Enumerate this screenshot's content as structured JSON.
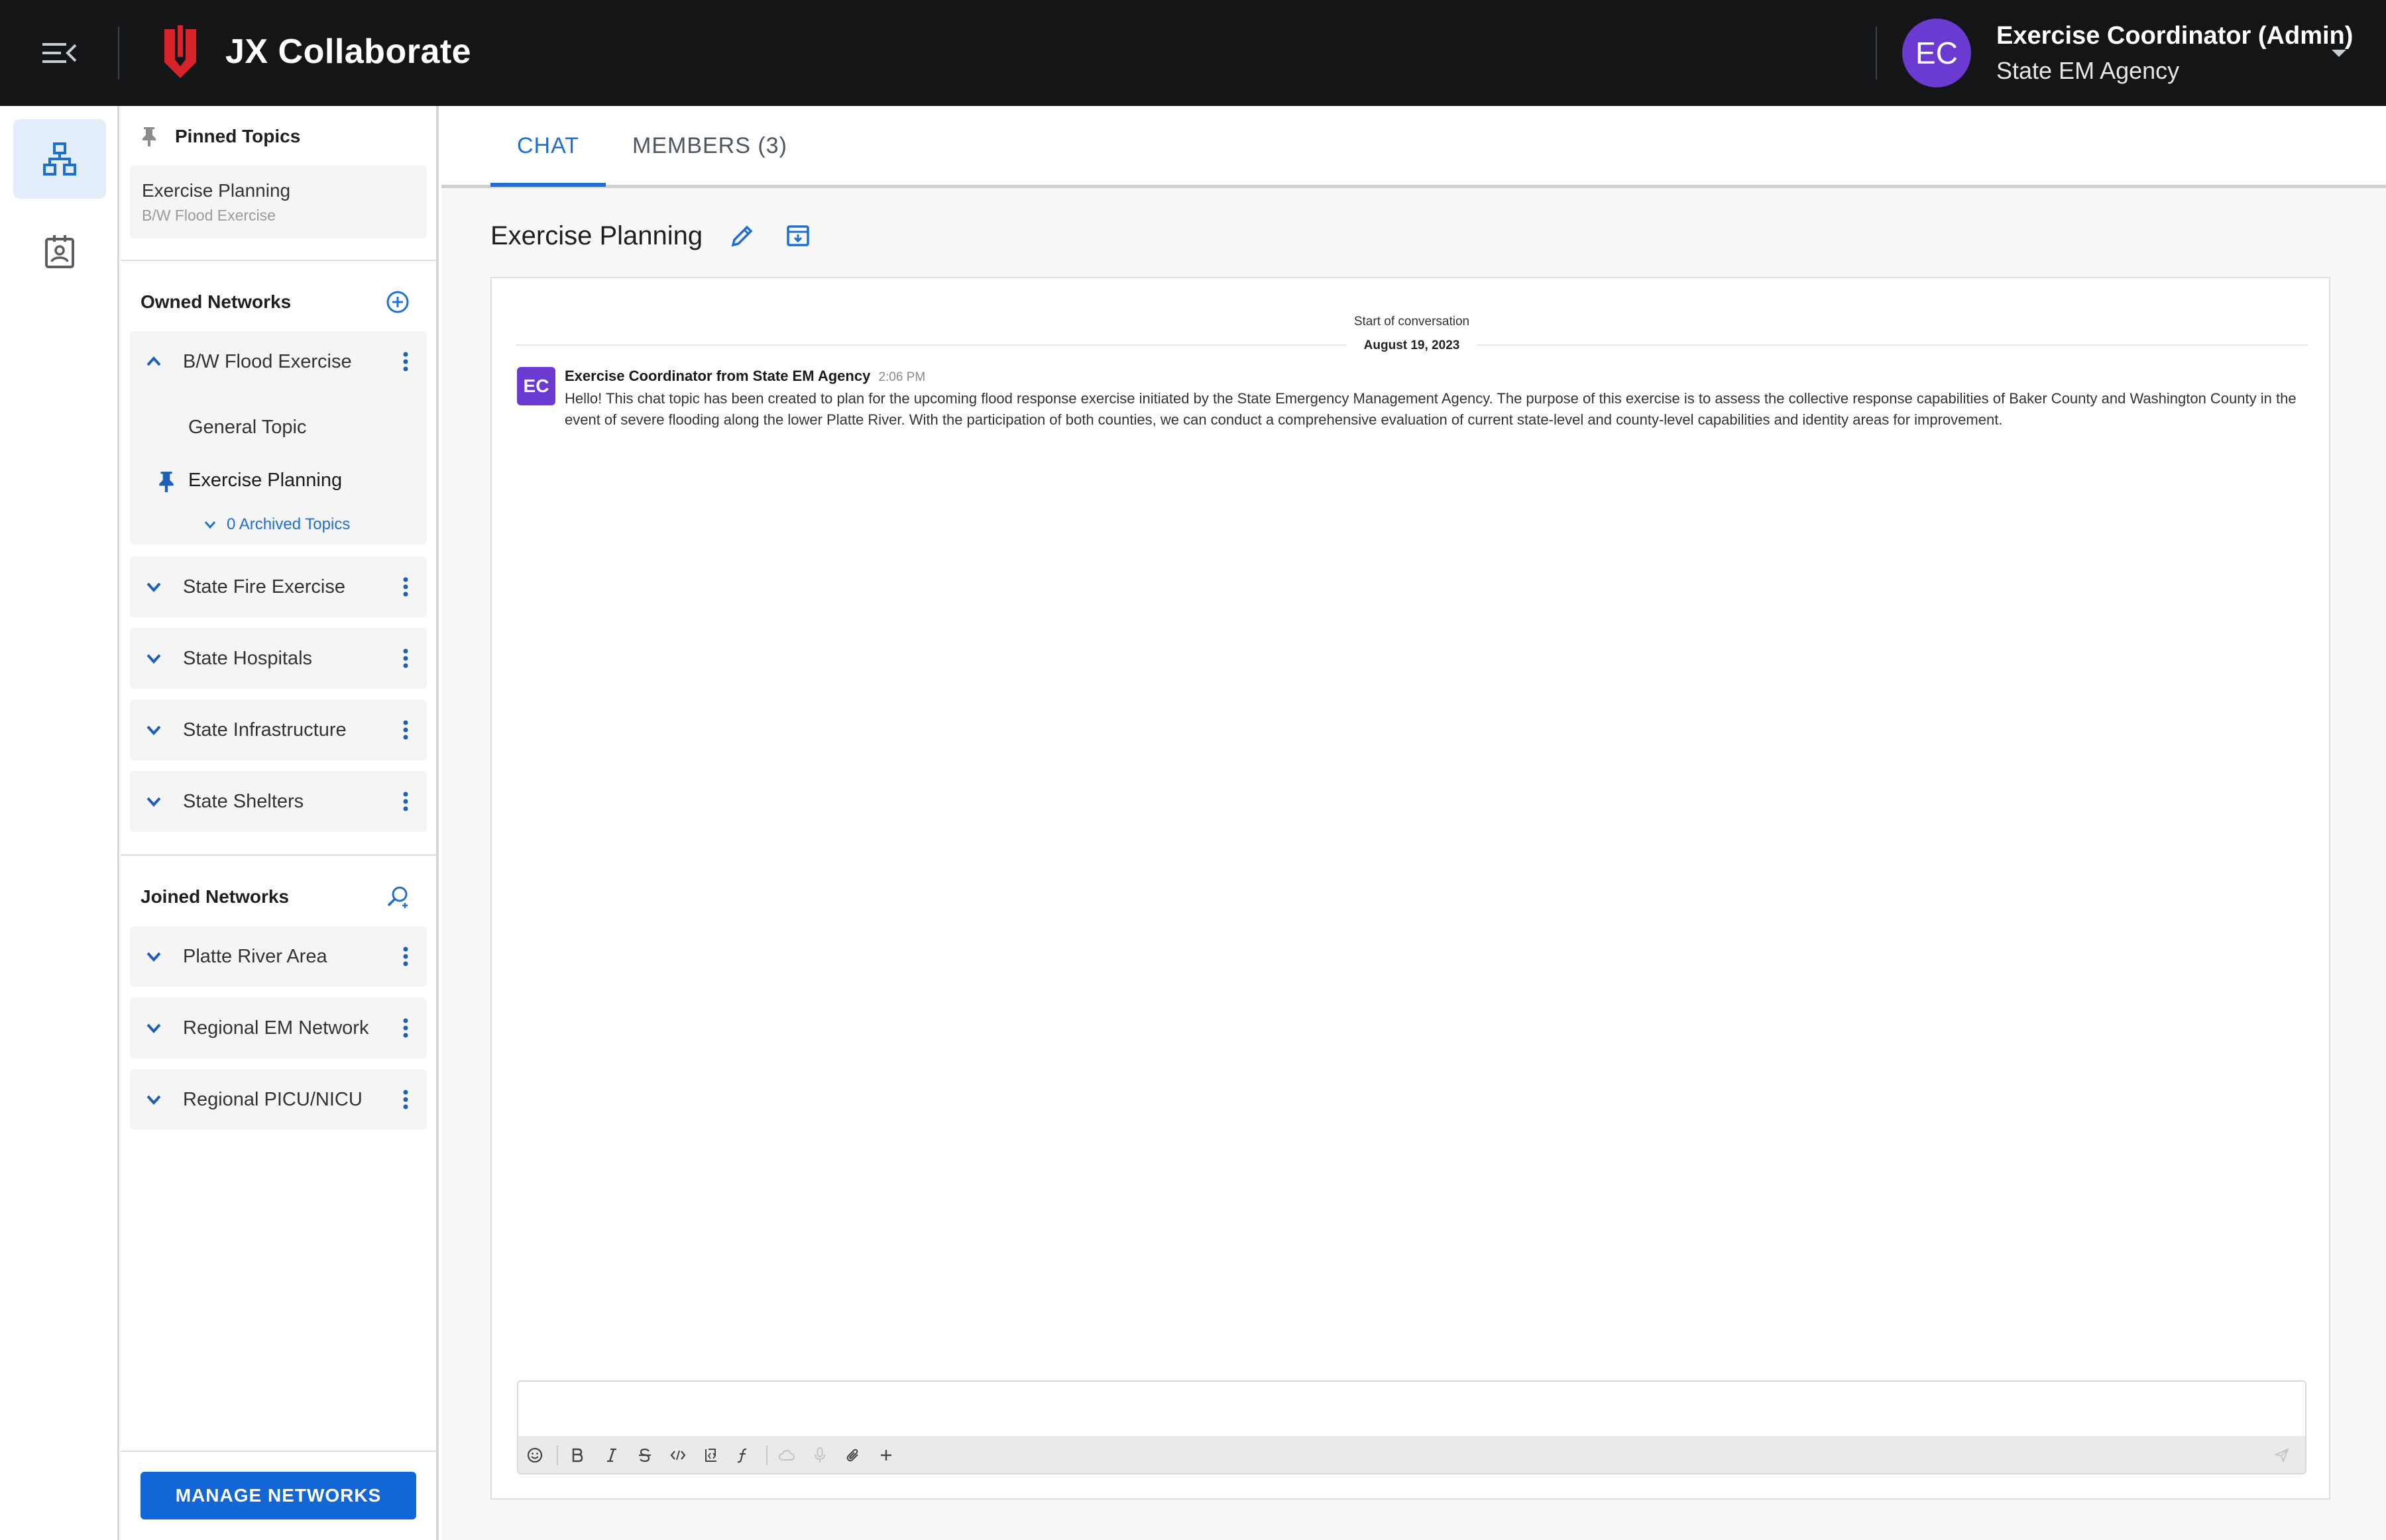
{
  "app": {
    "title": "JX Collaborate"
  },
  "user": {
    "initials": "EC",
    "name": "Exercise Coordinator (Admin)",
    "org": "State EM Agency"
  },
  "sidebar": {
    "pinned_header": "Pinned Topics",
    "pinned": {
      "topic": "Exercise Planning",
      "network": "B/W Flood Exercise"
    },
    "owned_header": "Owned Networks",
    "owned_expanded": {
      "name": "B/W Flood Exercise",
      "topics": [
        "General Topic",
        "Exercise Planning"
      ],
      "archived_label": "0 Archived Topics"
    },
    "owned_networks": [
      "State Fire Exercise",
      "State Hospitals",
      "State Infrastructure",
      "State Shelters"
    ],
    "joined_header": "Joined Networks",
    "joined_networks": [
      "Platte River Area",
      "Regional EM Network",
      "Regional PICU/NICU"
    ],
    "manage_button": "MANAGE NETWORKS"
  },
  "tabs": [
    {
      "label": "CHAT",
      "active": true
    },
    {
      "label": "MEMBERS (3)",
      "active": false
    }
  ],
  "topic": {
    "title": "Exercise Planning"
  },
  "chat": {
    "start_label": "Start of conversation",
    "date": "August 19, 2023",
    "messages": [
      {
        "avatar": "EC",
        "author": "Exercise Coordinator from State EM Agency",
        "time": "2:06 PM",
        "text": "Hello! This chat topic has been created to plan for the upcoming flood response exercise initiated by the State Emergency Management Agency. The purpose of this exercise is to assess the collective response capabilities of Baker County and Washington County in the event of severe flooding along the lower Platte River. With the participation of both counties, we can conduct a comprehensive evaluation of current state-level and county-level capabilities and identity areas for improvement."
      }
    ]
  },
  "composer": {
    "placeholder": "",
    "toolbar": [
      "emoji-icon",
      "bold-icon",
      "italic-icon",
      "strikethrough-icon",
      "code-icon",
      "code-block-icon",
      "formula-icon",
      "cloud-icon",
      "mic-icon",
      "attach-icon",
      "plus-icon",
      "send-icon"
    ]
  },
  "colors": {
    "accent": "#1f6fd1",
    "topbar": "#131517",
    "avatar": "#6b3ad0",
    "logo": "#d8222a",
    "manage_button": "#1366d6"
  }
}
